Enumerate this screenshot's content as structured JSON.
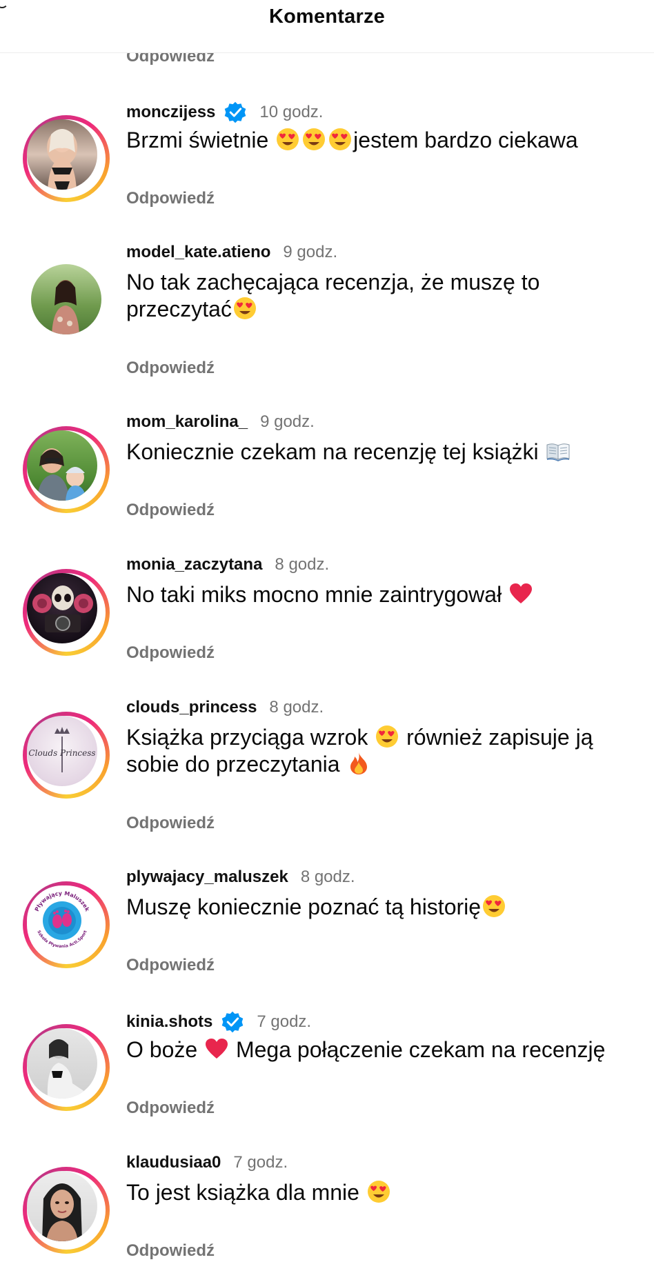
{
  "header": {
    "title": "Komentarze"
  },
  "partial": {
    "reply_label": "Odpowiedź"
  },
  "comments": [
    {
      "username": "monczijess",
      "verified": true,
      "time": "10 godz.",
      "text_parts": [
        "Brzmi świetnie ",
        "jestem bardzo ciekawa"
      ],
      "emojis": [
        "heart-eyes-emoji",
        "heart-eyes-emoji",
        "heart-eyes-emoji"
      ],
      "reply_label": "Odpowiedź"
    },
    {
      "username": "model_kate.atieno",
      "verified": false,
      "time": "9 godz.",
      "text_parts": [
        "No tak zachęcająca recenzja, że muszę to przeczytać"
      ],
      "emojis": [
        "heart-eyes-emoji"
      ],
      "reply_label": "Odpowiedź"
    },
    {
      "username": "mom_karolina_",
      "verified": false,
      "time": "9 godz.",
      "text_parts": [
        "Koniecznie czekam na recenzję tej książki "
      ],
      "emojis": [
        "open-book-emoji"
      ],
      "reply_label": "Odpowiedź"
    },
    {
      "username": "monia_zaczytana",
      "verified": false,
      "time": "8 godz.",
      "text_parts": [
        "No taki miks mocno mnie zaintrygował "
      ],
      "emojis": [
        "red-heart-emoji"
      ],
      "reply_label": "Odpowiedź"
    },
    {
      "username": "clouds_princess",
      "verified": false,
      "time": "8 godz.",
      "text_parts": [
        "Książka przyciąga wzrok ",
        " również zapisuje ją sobie do przeczytania "
      ],
      "emojis": [
        "heart-eyes-emoji",
        "fire-emoji"
      ],
      "reply_label": "Odpowiedź",
      "avatar_text": "Clouds Princess"
    },
    {
      "username": "plywajacy_maluszek",
      "verified": false,
      "time": "8 godz.",
      "text_parts": [
        "Muszę koniecznie poznać tą historię"
      ],
      "emojis": [
        "heart-eyes-emoji"
      ],
      "reply_label": "Odpowiedź",
      "avatar_text_top": "Pływający Maluszek",
      "avatar_text_bottom": "Szkoła Pływania Acti.Sport"
    },
    {
      "username": "kinia.shots",
      "verified": true,
      "time": "7 godz.",
      "text_parts": [
        "O boże ",
        " Mega połączenie czekam na recenzję"
      ],
      "emojis": [
        "red-heart-emoji"
      ],
      "reply_label": "Odpowiedź"
    },
    {
      "username": "klaudusiaa0",
      "verified": false,
      "time": "7 godz.",
      "text_parts": [
        "To jest książka dla mnie "
      ],
      "emojis": [
        "heart-eyes-emoji"
      ],
      "reply_label": "Odpowiedź"
    }
  ],
  "colors": {
    "secondary_text": "#737373",
    "verified_blue": "#0095f6",
    "story_ring": [
      "#f9ce34",
      "#ee2a7b",
      "#c13584"
    ]
  }
}
